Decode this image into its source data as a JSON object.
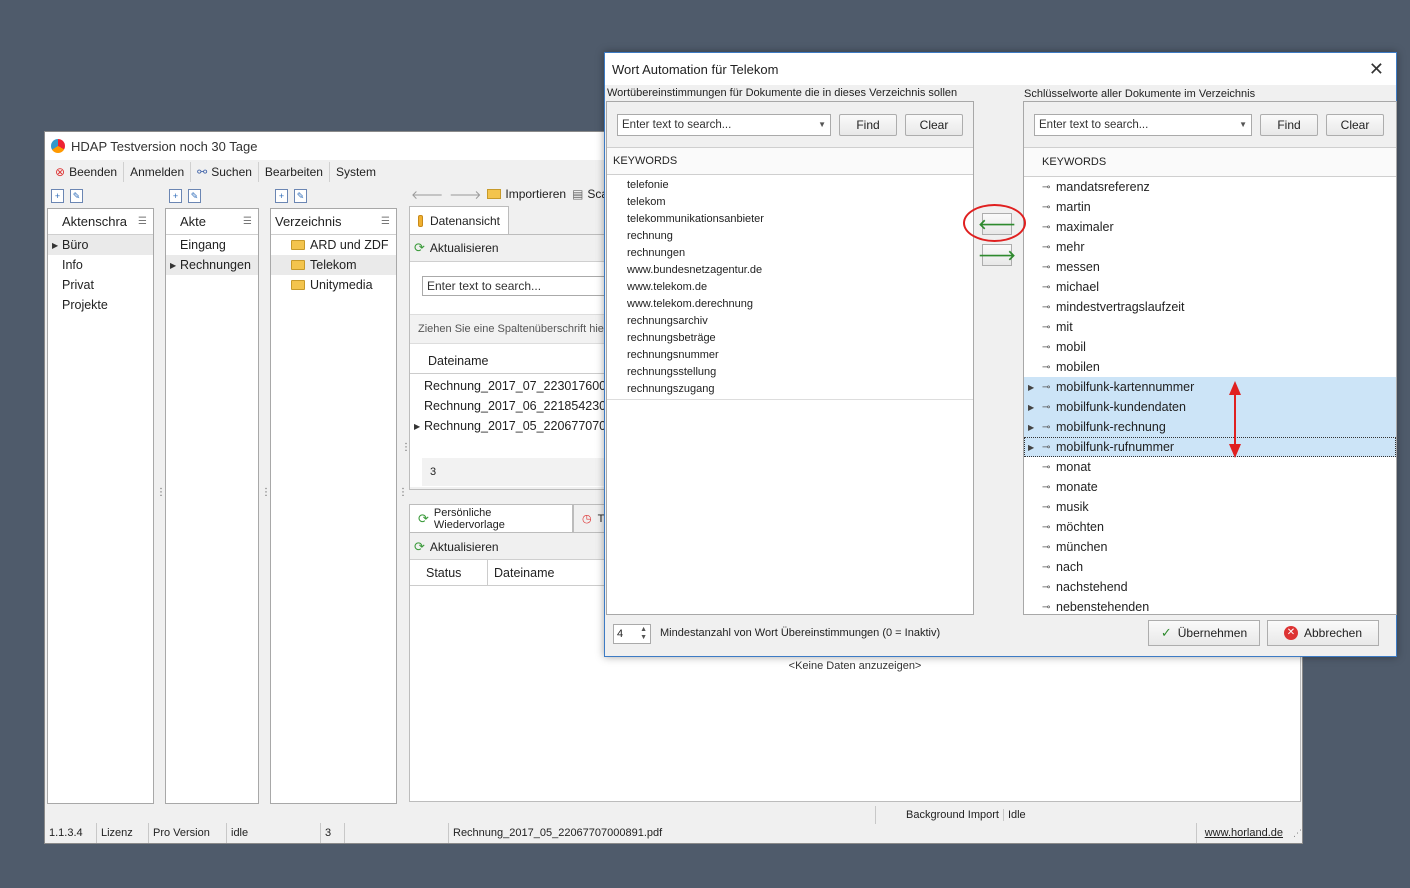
{
  "main_window": {
    "title": "HDAP Testversion noch 30 Tage",
    "menu": [
      "Beenden",
      "Anmelden",
      "Suchen",
      "Bearbeiten",
      "System"
    ],
    "panels": {
      "aktenschrank": {
        "header": "Aktenschra",
        "items": [
          "Büro",
          "Info",
          "Privat",
          "Projekte"
        ]
      },
      "akte": {
        "header": "Akte",
        "items": [
          "Eingang",
          "Rechnungen"
        ]
      },
      "verzeichnis": {
        "header": "Verzeichnis",
        "items": [
          "ARD und ZDF",
          "Telekom",
          "Unitymedia"
        ]
      }
    },
    "toolbar": {
      "import": "Importieren",
      "scan": "Scanne"
    },
    "datenansicht": {
      "tab": "Datenansicht",
      "refresh": "Aktualisieren",
      "search_placeholder": "Enter text to search...",
      "group_hint": "Ziehen Sie eine Spaltenüberschrift hierh",
      "column": "Dateiname",
      "rows": [
        "Rechnung_2017_07_223017600",
        "Rechnung_2017_06_221854230",
        "Rechnung_2017_05_220677070"
      ],
      "count": "3"
    },
    "wiedervorlage": {
      "tab": "Persönliche Wiedervorlage",
      "tab2": "T",
      "refresh": "Aktualisieren",
      "columns": [
        "Status",
        "Dateiname"
      ],
      "empty": "<Keine Daten anzuzeigen>"
    },
    "background_import": {
      "label": "Background Import",
      "state": "Idle"
    },
    "statusbar": {
      "version": "1.1.3.4",
      "license": "Lizenz",
      "edition": "Pro Version",
      "state": "idle",
      "count": "3",
      "file": "Rechnung_2017_05_22067707000891.pdf",
      "link": "www.horland.de"
    }
  },
  "dialog": {
    "title": "Wort Automation für Telekom",
    "left_label": "Wortübereinstimmungen für Dokumente die in dieses Verzeichnis sollen",
    "right_label": "Schlüsselworte aller Dokumente im Verzeichnis",
    "search_placeholder": "Enter text to search...",
    "find": "Find",
    "clear": "Clear",
    "column": "KEYWORDS",
    "left_keywords": [
      "telefonie",
      "telekom",
      "telekommunikationsanbieter",
      "rechnung",
      "rechnungen",
      "www.bundesnetzagentur.de",
      "www.telekom.de",
      "www.telekom.derechnung",
      "rechnungsarchiv",
      "rechnungsbeträge",
      "rechnungsnummer",
      "rechnungsstellung",
      "rechnungszugang"
    ],
    "right_keywords": [
      "mandatsreferenz",
      "martin",
      "maximaler",
      "mehr",
      "messen",
      "michael",
      "mindestvertragslaufzeit",
      "mit",
      "mobil",
      "mobilen",
      "mobilfunk-kartennummer",
      "mobilfunk-kundendaten",
      "mobilfunk-rechnung",
      "mobilfunk-rufnummer",
      "monat",
      "monate",
      "musik",
      "möchten",
      "münchen",
      "nach",
      "nachstehend",
      "nebenstehenden"
    ],
    "highlighted": [
      10,
      11,
      12,
      13
    ],
    "min_value": "4",
    "min_label": "Mindestanzahl von Wort Übereinstimmungen (0 = Inaktiv)",
    "ok": "Übernehmen",
    "cancel": "Abbrechen",
    "accent_color": "#cce4f7",
    "annotation_color": "#e02020"
  }
}
